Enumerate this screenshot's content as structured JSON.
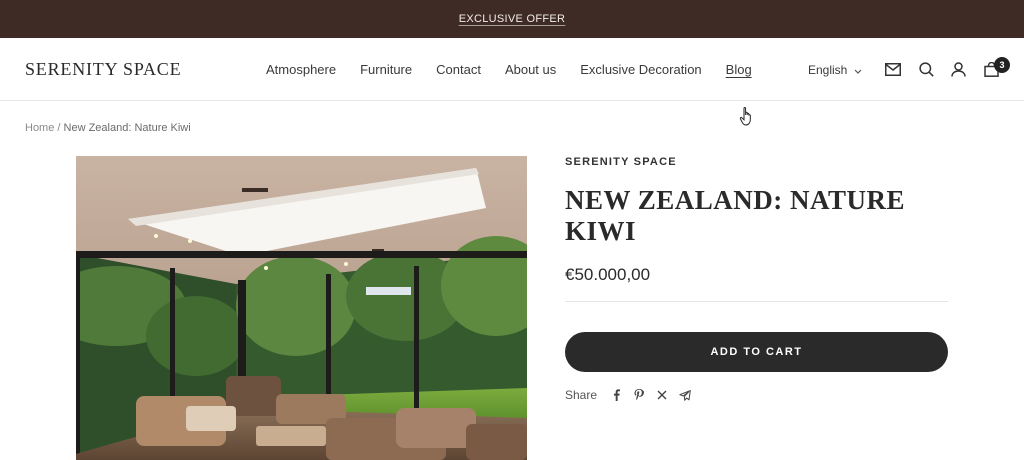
{
  "announcement": {
    "text": "EXCLUSIVE OFFER"
  },
  "header": {
    "logo": "SERENITY SPACE",
    "nav": [
      "Atmosphere",
      "Furniture",
      "Contact",
      "About us",
      "Exclusive Decoration",
      "Blog"
    ],
    "language": "English",
    "cart_count": "3",
    "icons": [
      "mail-icon",
      "search-icon",
      "account-icon",
      "cart-icon",
      "chevron-down-icon"
    ]
  },
  "breadcrumb": {
    "home": "Home",
    "separator": "/",
    "current": "New Zealand: Nature Kiwi"
  },
  "product": {
    "vendor": "SERENITY SPACE",
    "title": "NEW ZEALAND: NATURE KIWI",
    "price": "€50.000,00",
    "add_to_cart": "ADD TO CART",
    "share_label": "Share",
    "share_icons": [
      "facebook-icon",
      "pinterest-icon",
      "x-icon",
      "telegram-icon"
    ]
  },
  "colors": {
    "announcement_bg": "#3e2b25",
    "button_bg": "#2a2a2a",
    "text": "#2b2b2b"
  }
}
